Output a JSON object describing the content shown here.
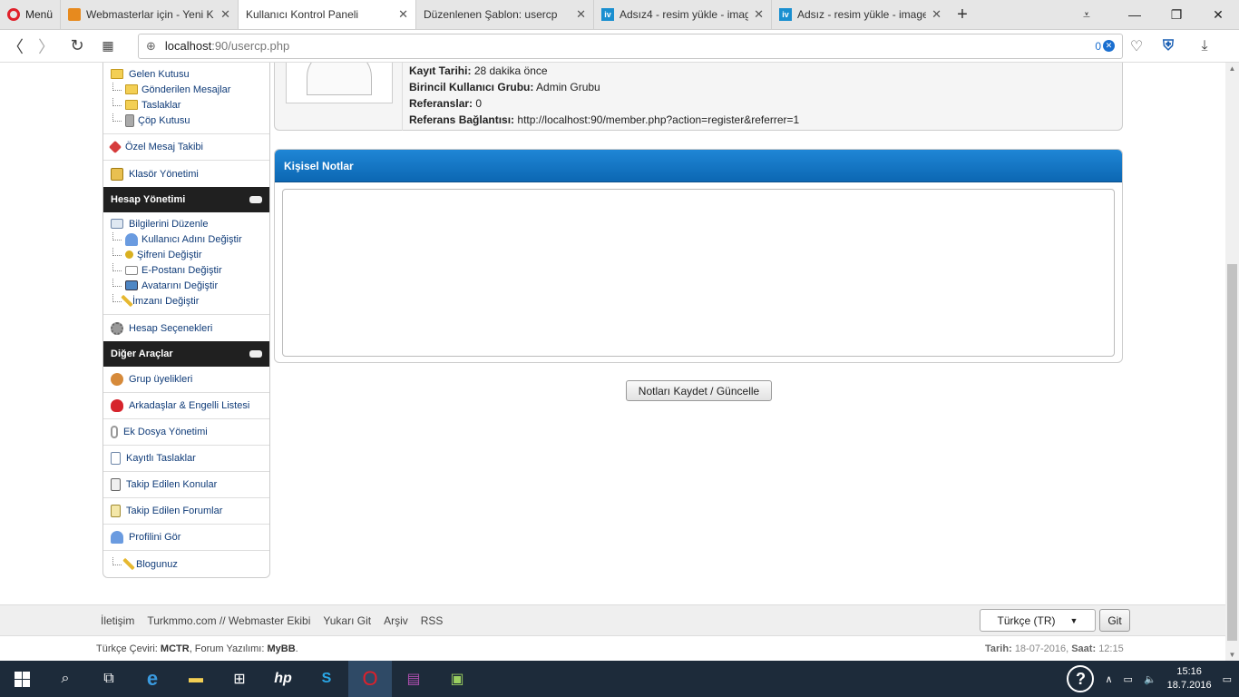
{
  "browser": {
    "menu_label": "Menü",
    "tabs": [
      {
        "title": "Webmasterlar için - Yeni K",
        "icon": "webmaster-favicon"
      },
      {
        "title": "Kullanıcı Kontrol Paneli",
        "icon": "page-favicon",
        "active": true
      },
      {
        "title": "Düzenlenen Şablon: usercp",
        "icon": "page-favicon"
      },
      {
        "title": "Adsız4 - resim yükle - imag",
        "icon": "iv-favicon"
      },
      {
        "title": "Adsız - resim yükle - image",
        "icon": "iv-favicon"
      }
    ],
    "url_host": "localhost",
    "url_path": ":90/usercp.php",
    "adblock_count": "0"
  },
  "sidebar": {
    "messages": {
      "inbox": "Gelen Kutusu",
      "sent": "Gönderilen Mesajlar",
      "drafts": "Taslaklar",
      "trash": "Çöp Kutusu"
    },
    "pm_tracking": "Özel Mesaj Takibi",
    "folders": "Klasör Yönetimi",
    "account_section": "Hesap Yönetimi",
    "account": {
      "edit_profile": "Bilgilerini Düzenle",
      "change_username": "Kullanıcı Adını Değiştir",
      "change_password": "Şifreni Değiştir",
      "change_email": "E-Postanı Değiştir",
      "change_avatar": "Avatarını Değiştir",
      "change_signature": "İmzanı Değiştir"
    },
    "options": "Hesap Seçenekleri",
    "other_section": "Diğer Araçlar",
    "other": {
      "groups": "Grup üyelikleri",
      "buddy": "Arkadaşlar & Engelli Listesi",
      "attachments": "Ek Dosya Yönetimi",
      "saved_drafts": "Kayıtlı Taslaklar",
      "subscribed_threads": "Takip Edilen Konular",
      "subscribed_forums": "Takip Edilen Forumlar",
      "view_profile": "Profilini Gör",
      "blog": "Blogunuz"
    }
  },
  "profile": {
    "reg_label": "Kayıt Tarihi:",
    "reg_value": "28 dakika önce",
    "group_label": "Birincil Kullanıcı Grubu:",
    "group_value": "Admin Grubu",
    "ref_label": "Referanslar:",
    "ref_value": "0",
    "reflink_label": "Referans Bağlantısı:",
    "reflink_value": "http://localhost:90/member.php?action=register&referrer=1"
  },
  "notes": {
    "title": "Kişisel Notlar",
    "value": "",
    "save_label": "Notları Kaydet / Güncelle"
  },
  "footer": {
    "links": [
      "İletişim",
      "Turkmmo.com // Webmaster Ekibi",
      "Yukarı Git",
      "Arşiv",
      "RSS"
    ],
    "language": "Türkçe (TR)",
    "go_label": "Git",
    "credits_prefix": "Türkçe Çeviri:",
    "credits_translator": "MCTR",
    "credits_mid": ", Forum Yazılımı:",
    "credits_software": "MyBB",
    "date_label": "Tarih:",
    "date_value": "18-07-2016",
    "time_label": "Saat:",
    "time_value": "12:15"
  },
  "taskbar": {
    "time": "15:16",
    "date": "18.7.2016"
  },
  "colors": {
    "header_blue": "#0c67b3",
    "sidebar_dark": "#202020",
    "link": "#0f3b78"
  }
}
